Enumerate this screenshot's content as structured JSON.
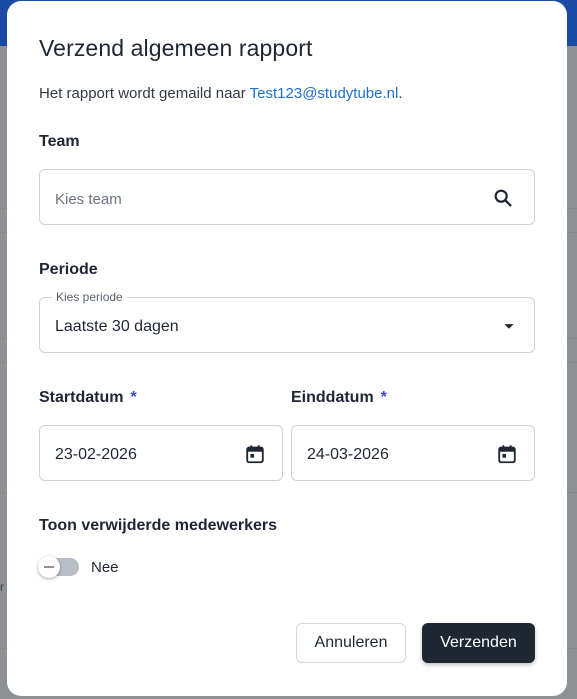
{
  "dialog": {
    "title": "Verzend algemeen rapport",
    "subtitle_prefix": "Het rapport wordt gemaild naar ",
    "email": "Test123@studytube.nl",
    "subtitle_suffix": "."
  },
  "team": {
    "label": "Team",
    "placeholder": "Kies team",
    "icon": "search-icon"
  },
  "period": {
    "label": "Periode",
    "field_label": "Kies periode",
    "selected": "Laatste 30 dagen",
    "icon": "caret-down-icon"
  },
  "start_date": {
    "label": "Startdatum",
    "required_marker": "*",
    "value": "23-02-2026",
    "icon": "calendar-icon"
  },
  "end_date": {
    "label": "Einddatum",
    "required_marker": "*",
    "value": "24-03-2026",
    "icon": "calendar-icon"
  },
  "deleted_employees": {
    "label": "Toon verwijderde medewerkers",
    "toggle_state": "off",
    "toggle_text": "Nee"
  },
  "actions": {
    "cancel": "Annuleren",
    "submit": "Verzenden"
  },
  "background": {
    "fragment": "r"
  },
  "colors": {
    "accent_link": "#1f6fd1",
    "required_marker": "#3b4ad8",
    "primary_button": "#1f2733",
    "backdrop": "#8e9094",
    "topbar": "#1a4aa3"
  }
}
